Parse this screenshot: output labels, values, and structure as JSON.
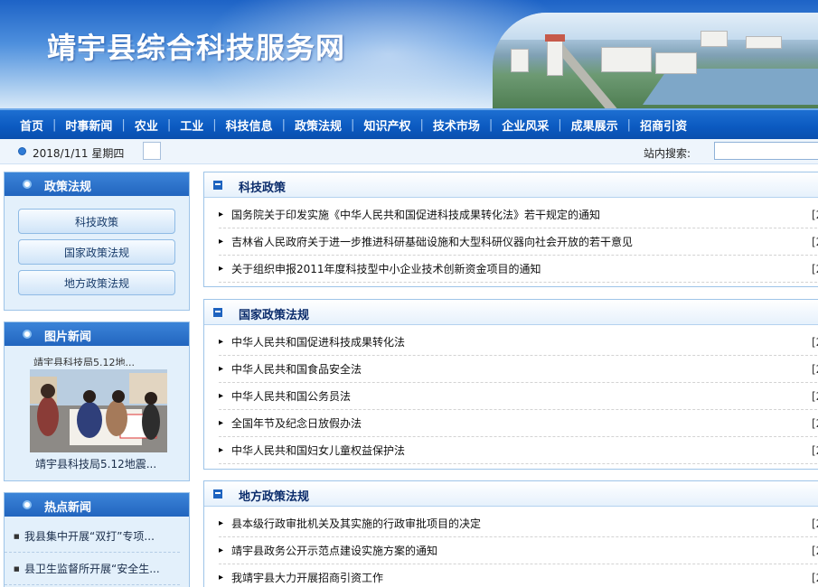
{
  "header": {
    "site_title": "靖宇县综合科技服务网"
  },
  "nav": {
    "items": [
      "首页",
      "时事新闻",
      "农业",
      "工业",
      "科技信息",
      "政策法规",
      "知识产权",
      "技术市场",
      "企业风采",
      "成果展示",
      "招商引资"
    ]
  },
  "datebar": {
    "date": "2018/1/11 星期四",
    "search_label": "站内搜索:",
    "search_value": ""
  },
  "sidebar": {
    "policy": {
      "title": "政策法规",
      "items": [
        "科技政策",
        "国家政策法规",
        "地方政策法规"
      ]
    },
    "photo_news": {
      "title": "图片新闻",
      "strip": "靖宇县科技局5.12地...",
      "caption": "靖宇县科技局5.12地震..."
    },
    "hot_news": {
      "title": "热点新闻",
      "items": [
        "我县集中开展“双打”专项...",
        "县卫生监督所开展“安全生..."
      ]
    }
  },
  "panels": [
    {
      "title": "科技政策",
      "items": [
        {
          "text": "国务院关于印发实施《中华人民共和国促进科技成果转化法》若干规定的通知",
          "date": "[2"
        },
        {
          "text": "吉林省人民政府关于进一步推进科研基础设施和大型科研仪器向社会开放的若干意见",
          "date": "[2"
        },
        {
          "text": "关于组织申报2011年度科技型中小企业技术创新资金项目的通知",
          "date": "[2"
        }
      ]
    },
    {
      "title": "国家政策法规",
      "items": [
        {
          "text": "中华人民共和国促进科技成果转化法",
          "date": "[2"
        },
        {
          "text": "中华人民共和国食品安全法",
          "date": "[2"
        },
        {
          "text": "中华人民共和国公务员法",
          "date": "[2"
        },
        {
          "text": "全国年节及纪念日放假办法",
          "date": "[2"
        },
        {
          "text": "中华人民共和国妇女儿童权益保护法",
          "date": "[2"
        }
      ]
    },
    {
      "title": "地方政策法规",
      "items": [
        {
          "text": "县本级行政审批机关及其实施的行政审批项目的决定",
          "date": "[2"
        },
        {
          "text": "靖宇县政务公开示范点建设实施方案的通知",
          "date": "[2"
        },
        {
          "text": "我靖宇县大力开展招商引资工作",
          "date": "[2"
        }
      ]
    }
  ]
}
